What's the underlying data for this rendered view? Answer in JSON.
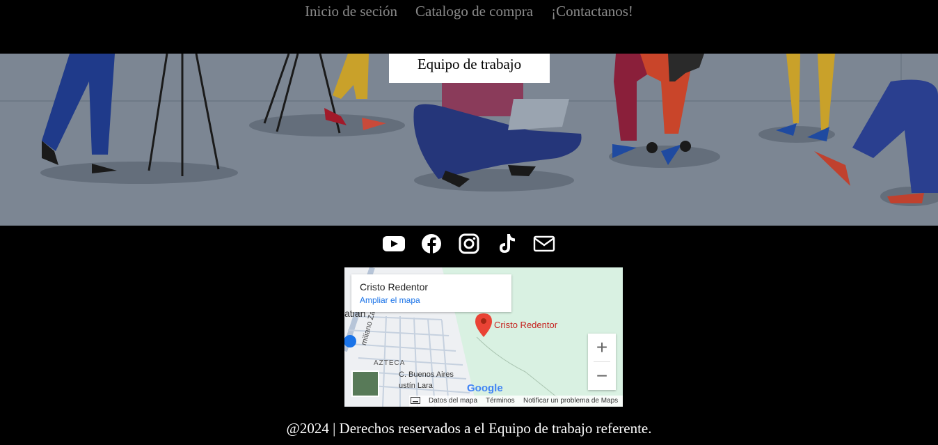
{
  "nav": {
    "links": [
      {
        "label": "Inicio de seción"
      },
      {
        "label": "Catalogo de compra"
      },
      {
        "label": "¡Contactanos!"
      }
    ]
  },
  "hero": {
    "title": "Equipo de trabajo"
  },
  "social": {
    "icons": [
      "youtube-icon",
      "facebook-icon",
      "instagram-icon",
      "tiktok-icon",
      "mail-icon"
    ]
  },
  "map": {
    "place_name": "Cristo Redentor",
    "enlarge_link": "Ampliar el mapa",
    "pin_label": "Cristo Redentor",
    "zoom_in": "+",
    "zoom_out": "−",
    "labels": {
      "district": "AZTECA",
      "street1": "C. Buenos Aires",
      "street2": "ustín Lara",
      "street3": "miliano Zapata",
      "city": "atian"
    },
    "google_logo": "Google",
    "footer": {
      "map_data": "Datos del mapa",
      "terms": "Términos",
      "report": "Notificar un problema de Maps"
    }
  },
  "footer": {
    "text": "@2024 | Derechos reservados a el Equipo de trabajo referente."
  }
}
